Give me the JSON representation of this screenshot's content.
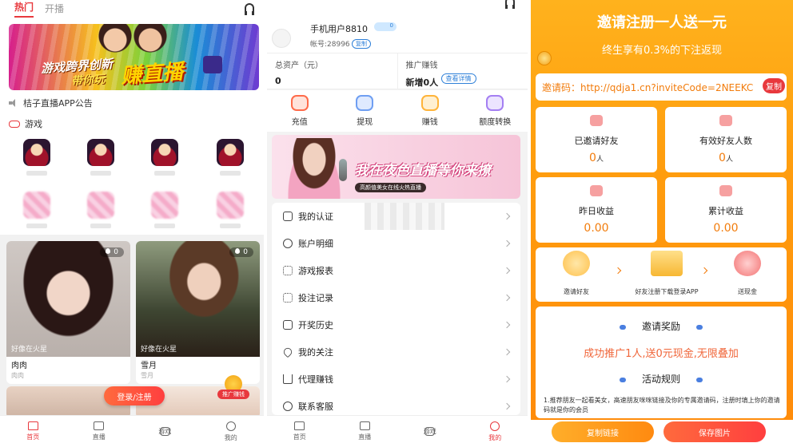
{
  "screen1": {
    "tabs": [
      {
        "label": "热门"
      },
      {
        "label": "开播"
      }
    ],
    "banner": {
      "line1": "游戏跨界创新",
      "line2": "带你玩",
      "line3": "赚直播"
    },
    "notice": "桔子直播APP公告",
    "games_title": "游戏",
    "feed": [
      {
        "heat": "0",
        "overlay": "好像在火星",
        "name": "肉肉",
        "sub": "肉肉"
      },
      {
        "heat": "0",
        "overlay": "好像在火星",
        "name": "雪月",
        "sub": "雪月"
      }
    ],
    "login_button": "登录/注册",
    "promo_badge": "推广赚钱",
    "tabbar": [
      {
        "label": "首页"
      },
      {
        "label": "直播"
      },
      {
        "label": "游戏"
      },
      {
        "label": "我的"
      }
    ]
  },
  "screen2": {
    "username": "手机用户8810",
    "vip_level": "0",
    "account": "帐号:28996",
    "copy_label": "复制",
    "assets_label": "总资产（元）",
    "assets_value": "0",
    "promo_label": "推广赚钱",
    "promo_value": "新增0人",
    "promo_detail": "查看详情",
    "quick_actions": [
      {
        "label": "充值"
      },
      {
        "label": "提现"
      },
      {
        "label": "赚钱"
      },
      {
        "label": "额度转换"
      }
    ],
    "banner": {
      "title": "我在夜色直播等你来撩",
      "tag": "高颜值美女在线火热直播"
    },
    "menu": [
      {
        "label": "我的认证"
      },
      {
        "label": "账户明细"
      },
      {
        "label": "游戏报表"
      },
      {
        "label": "投注记录"
      },
      {
        "label": "开奖历史"
      },
      {
        "label": "我的关注"
      },
      {
        "label": "代理赚钱"
      },
      {
        "label": "联系客服"
      }
    ],
    "tabbar": [
      {
        "label": "首页"
      },
      {
        "label": "直播"
      },
      {
        "label": "游戏"
      },
      {
        "label": "我的"
      }
    ]
  },
  "screen3": {
    "title": "邀请注册一人送一元",
    "subtitle": "终生享有0.3%的下注返现",
    "invite_code": "邀请码：http://qdja1.cn?inviteCode=2NEEKC",
    "copy_label": "复制",
    "stats": [
      {
        "label": "已邀请好友",
        "value": "0",
        "unit": "人"
      },
      {
        "label": "有效好友人数",
        "value": "0",
        "unit": "人"
      },
      {
        "label": "昨日收益",
        "value": "0.00",
        "unit": ""
      },
      {
        "label": "累计收益",
        "value": "0.00",
        "unit": ""
      }
    ],
    "steps": [
      {
        "label": "邀请好友"
      },
      {
        "label": "好友注册下载登录APP"
      },
      {
        "label": "送现金"
      }
    ],
    "rewards_title": "邀请奖励",
    "reward_text": "成功推广1人,送0元现金,无限叠加",
    "rules_title": "活动规则",
    "rules_text": "1.推荐朋友一起看美女，高速朋友咪咪链接及你的专属邀请码，注册时填上你的邀请码就是你的会员",
    "buttons": {
      "copy_link": "复制链接",
      "save_image": "保存图片"
    }
  },
  "colors": {
    "accent": "#e8383d",
    "orange": "#ff9e0e",
    "blue": "#2d7fd8"
  }
}
